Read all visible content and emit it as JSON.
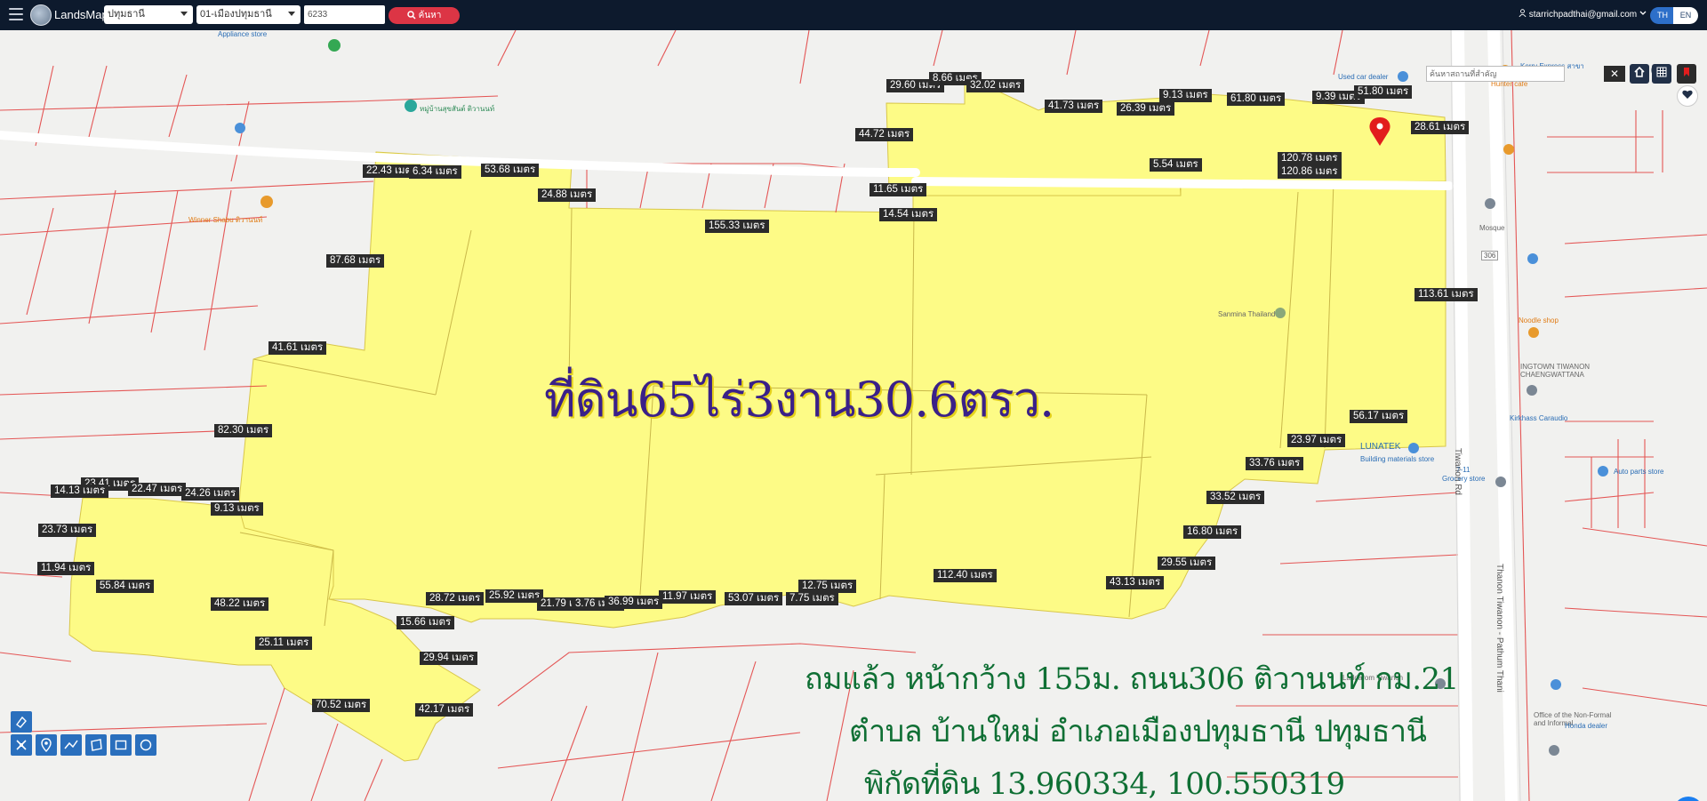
{
  "topbar": {
    "brand": "LandsMaps",
    "province": "ปทุมธานี",
    "district": "01-เมืองปทุมธานี",
    "search_value": "6233",
    "search_button": "ค้นหา",
    "user_email": "starrichpadthai@gmail.com",
    "lang_th": "TH",
    "lang_en": "EN"
  },
  "map": {
    "place_search_placeholder": "ค้นหาสถานที่สำคัญ",
    "title": "ที่ดิน65ไร่3งาน30.6ตรว.",
    "overlay_line1": "ถมแล้ว หน้ากว้าง 155ม. ถนน306 ติวานนท์ กม.21",
    "overlay_line2": "ตำบล บ้านใหม่ อำเภอเมืองปทุมธานี ปทุมธานี",
    "overlay_line3": "พิกัดที่ดิน 13.960334, 100.550319",
    "dimension_labels": [
      "29.60 เมตร",
      "8.66 เมตร",
      "32.02 เมตร",
      "41.73 เมตร",
      "26.39 เมตร",
      "9.13 เมตร",
      "61.80 เมตร",
      "9.39 เมตร",
      "51.80 เมตร",
      "44.72 เมตร",
      "28.61 เมตร",
      "22.43 เมตร",
      "6.34 เมตร",
      "53.68 เมตร",
      "5.54 เมตร",
      "120.78 เมตร",
      "120.86 เมตร",
      "24.88 เมตร",
      "11.65 เมตร",
      "14.54 เมตร",
      "155.33 เมตร",
      "87.68 เมตร",
      "113.61 เมตร",
      "41.61 เมตร",
      "56.17 เมตร",
      "82.30 เมตร",
      "23.97 เมตร",
      "33.76 เมตร",
      "23.41 เมตร",
      "14.13 เมตร",
      "22.47 เมตร",
      "24.26 เมตร",
      "9.13 เมตร",
      "33.52 เมตร",
      "23.73 เมตร",
      "16.80 เมตร",
      "11.94 เมตร",
      "29.55 เมตร",
      "55.84 เมตร",
      "48.22 เมตร",
      "112.40 เมตร",
      "43.13 เมตร",
      "12.75 เมตร",
      "28.72 เมตร",
      "25.92 เมตร",
      "21.79 เมตร",
      "3.76 เมตร",
      "36.99 เมตร",
      "11.97 เมตร",
      "53.07 เมตร",
      "7.75 เมตร",
      "15.66 เมตร",
      "25.11 เมตร",
      "29.94 เมตร",
      "70.52 เมตร",
      "42.17 เมตร"
    ],
    "pois": [
      "Appliance store",
      "Winner Shabu ติวานนท์",
      "หมู่บ้านสุขสันต์ ติวานนท์",
      "Hunter cafe",
      "Kerry Express สาขา",
      "Used car dealer",
      "Mosque",
      "Sanmina Thailand",
      "INGTOWN TIWANON CHAENGWATTANA",
      "Kirkhass Caraudio",
      "LUNATEK",
      "Building materials store",
      "7-11",
      "Grocery store",
      "Noodle shop",
      "Auto parts store",
      "Laddarom Tiwanon",
      "Office of the Non-Formal and Informal",
      "Honda dealer"
    ],
    "roads": [
      "Tiwanon Rd",
      "Thanon Tiwanon - Pathum Thani",
      "306"
    ]
  },
  "icons": [
    "menu-icon",
    "logo-icon",
    "search-icon",
    "user-icon",
    "chevron-down-icon",
    "home-icon",
    "grid-icon",
    "bookmark-icon",
    "heart-icon",
    "eraser-icon",
    "satellite-icon",
    "location-icon",
    "ruler-icon",
    "polygon-icon",
    "rectangle-icon",
    "circle-icon",
    "chat-icon",
    "map-pin-icon"
  ],
  "colors": {
    "topbar": "#0d1a2d",
    "land_fill": "#fdfb86",
    "parcel_line": "#e23b3b",
    "search_button": "#dc3545",
    "title_text": "#3a2089",
    "overlay_text": "#0f6f34"
  }
}
